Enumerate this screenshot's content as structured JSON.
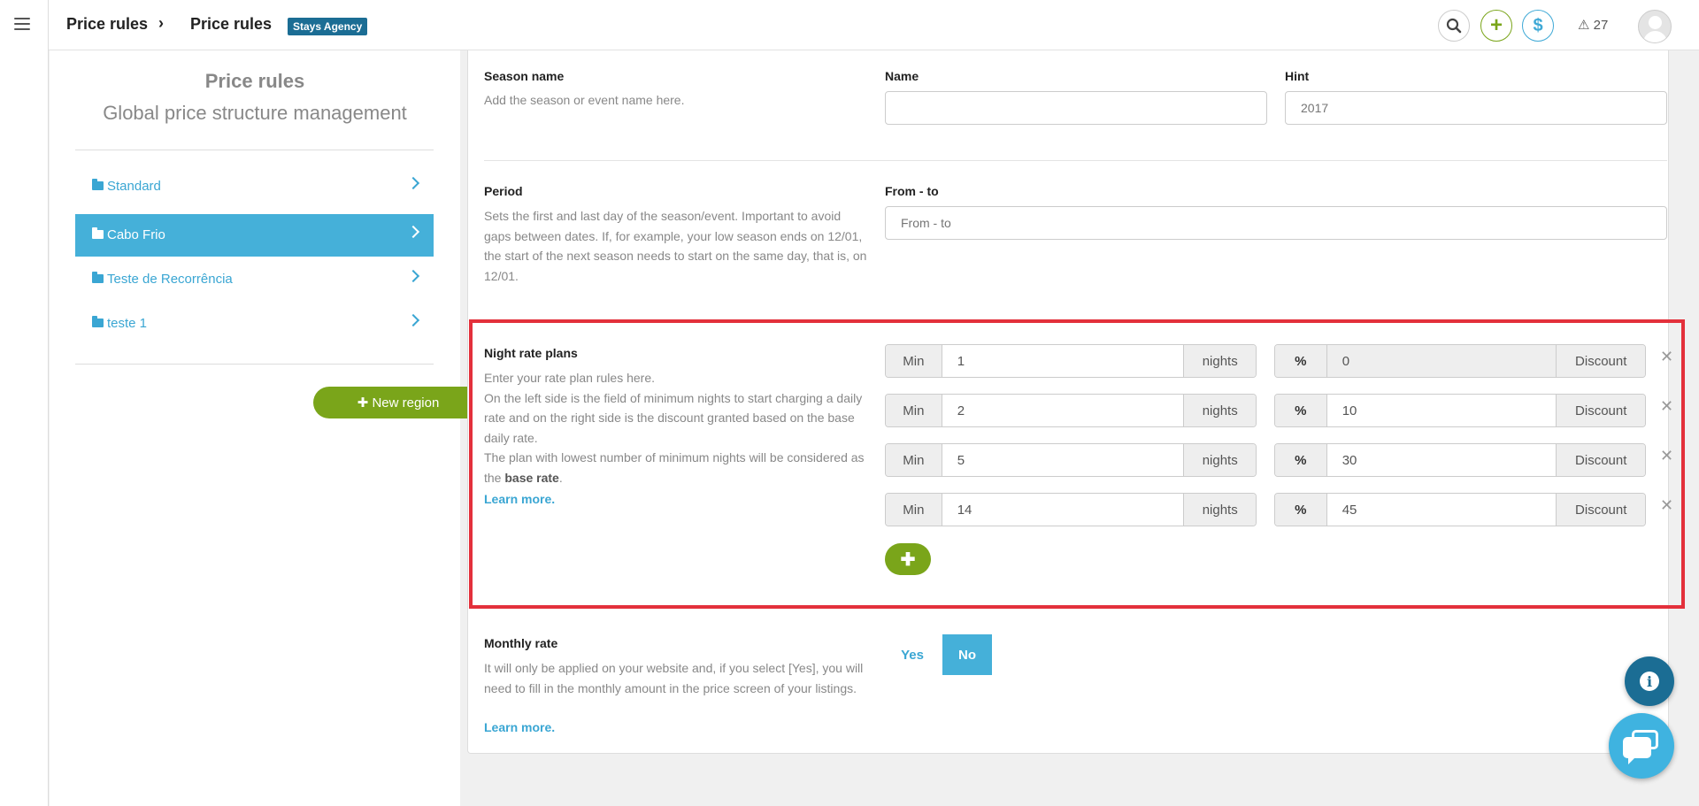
{
  "header": {
    "breadcrumb": [
      "Price rules",
      "Price rules"
    ],
    "agency_badge": "Stays Agency",
    "alerts_count": "27"
  },
  "icons": {
    "menu": "hamburger-icon",
    "search": "search-icon",
    "add": "plus-icon",
    "finance": "dollar-icon",
    "alerts": "warning-icon",
    "avatar": "user-avatar",
    "folder": "folder-icon",
    "chevron": "chevron-right-icon",
    "remove": "close-icon",
    "info": "info-icon",
    "chat": "chat-icon"
  },
  "sidebar": {
    "title": "Price rules",
    "subtitle": "Global price structure management",
    "regions": [
      {
        "label": "Standard",
        "active": false
      },
      {
        "label": "Cabo Frio",
        "active": true
      },
      {
        "label": "Teste de Recorrência",
        "active": false
      },
      {
        "label": "teste 1",
        "active": false
      }
    ],
    "new_region_label": "New region"
  },
  "season": {
    "title": "Season name",
    "description": "Add the season or event name here.",
    "name_label": "Name",
    "name_value": "",
    "hint_label": "Hint",
    "hint_placeholder": "2017"
  },
  "period": {
    "title": "Period",
    "description": "Sets the first and last day of the season/event. Important to avoid gaps between dates. If, for example, your low season ends on 12/01, the start of the next season needs to start on the same day, that is, on 12/01.",
    "range_label": "From - to",
    "range_placeholder": "From - to"
  },
  "night_rate": {
    "title": "Night rate plans",
    "description_1": "Enter your rate plan rules here.",
    "description_2": "On the left side is the field of minimum nights to start charging a daily rate and on the right side is the discount granted based on the base daily rate.",
    "description_3a": "The plan with lowest number of minimum nights will be considered as the ",
    "description_3b": "base rate",
    "description_3c": ".",
    "learn_more": "Learn more.",
    "min_label": "Min",
    "nights_label": "nights",
    "percent_label": "%",
    "discount_label": "Discount",
    "plans": [
      {
        "min": "1",
        "discount": "0"
      },
      {
        "min": "2",
        "discount": "10"
      },
      {
        "min": "5",
        "discount": "30"
      },
      {
        "min": "14",
        "discount": "45"
      }
    ]
  },
  "monthly": {
    "title": "Monthly rate",
    "description": "It will only be applied on your website and, if you select [Yes], you will need to fill in the monthly amount in the price screen of your listings.",
    "learn_more": "Learn more.",
    "yes_label": "Yes",
    "no_label": "No",
    "selected": "No"
  },
  "colors": {
    "accent_blue": "#45b0d9",
    "brand_green": "#7aa51a",
    "badge_navy": "#1b6d94",
    "highlight_red": "#e3303b"
  }
}
